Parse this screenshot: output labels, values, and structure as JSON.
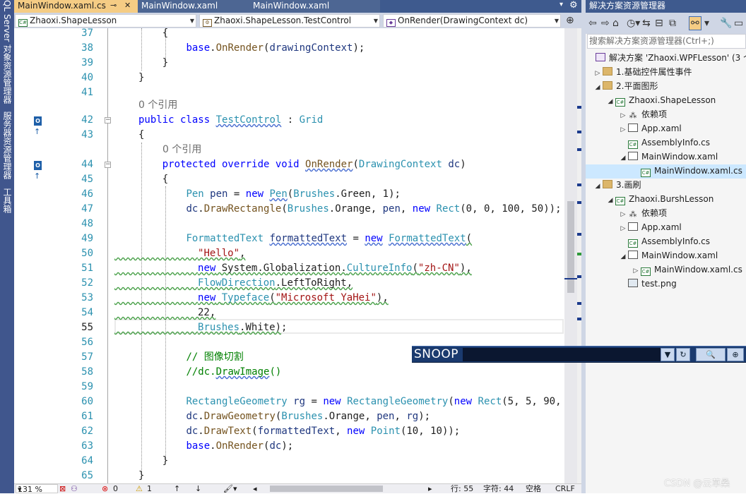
{
  "left_strip": {
    "labels": [
      "QL Server 对象资源管理器",
      "服务器资源管理器",
      "工具箱"
    ]
  },
  "tabs": [
    {
      "label": "MainWindow.xaml.cs",
      "active": true,
      "pin": "⊸",
      "close": "✕"
    },
    {
      "label": "MainWindow.xaml"
    },
    {
      "label": "MainWindow.xaml"
    }
  ],
  "tabbar_controls": {
    "dropdown": "▾",
    "gear": "⚙"
  },
  "nav": {
    "project": "Zhaoxi.ShapeLesson",
    "type": "Zhaoxi.ShapeLesson.TestControl",
    "member": "OnRender(DrawingContext dc)"
  },
  "editor": {
    "lines": [
      "37",
      "38",
      "39",
      "40",
      "41",
      "42",
      "43",
      "44",
      "45",
      "46",
      "47",
      "48",
      "49",
      "50",
      "51",
      "52",
      "53",
      "54",
      "55",
      "56",
      "57",
      "58",
      "59",
      "60",
      "61",
      "62",
      "63",
      "64",
      "65"
    ],
    "current_line": "55",
    "refs": [
      "0 个引用",
      "0 个引用"
    ]
  },
  "status": {
    "zoom": "131 %",
    "errors": "0",
    "warnings": "1",
    "line": "行: 55",
    "col": "字符: 44",
    "spacing": "空格",
    "eol": "CRLF"
  },
  "solution_explorer": {
    "title": "解决方案资源管理器",
    "search_placeholder": "搜索解决方案资源管理器(Ctrl+;)",
    "items": [
      {
        "label": "解决方案 'Zhaoxi.WPFLesson' (3 个"
      },
      {
        "label": "1.基础控件属性事件"
      },
      {
        "label": "2.平面图形"
      },
      {
        "label": "Zhaoxi.ShapeLesson"
      },
      {
        "label": "依赖项"
      },
      {
        "label": "App.xaml"
      },
      {
        "label": "AssemblyInfo.cs"
      },
      {
        "label": "MainWindow.xaml"
      },
      {
        "label": "MainWindow.xaml.cs"
      },
      {
        "label": "3.画刷"
      },
      {
        "label": "Zhaoxi.BurshLesson"
      },
      {
        "label": "依赖项"
      },
      {
        "label": "App.xaml"
      },
      {
        "label": "AssemblyInfo.cs"
      },
      {
        "label": "MainWindow.xaml"
      },
      {
        "label": "MainWindow.xaml.cs"
      },
      {
        "label": "test.png"
      }
    ]
  },
  "snoop": {
    "label": "SNOOP"
  },
  "watermark": "CSDN @云草桑",
  "colors": {
    "keyword": "#0000ff",
    "type": "#2b91af",
    "string": "#a31515",
    "comment": "#008000",
    "tab_active": "#f5cc84",
    "chrome": "#3e5a8e"
  }
}
